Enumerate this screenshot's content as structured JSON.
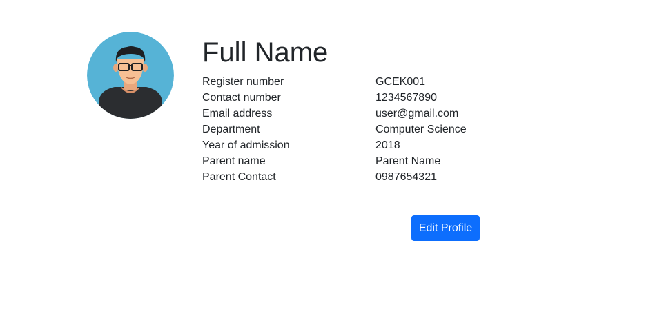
{
  "profile": {
    "name": "Full Name",
    "fields": [
      {
        "label": "Register number",
        "value": "GCEK001"
      },
      {
        "label": "Contact number",
        "value": "1234567890"
      },
      {
        "label": "Email address",
        "value": "user@gmail.com"
      },
      {
        "label": "Department",
        "value": "Computer Science"
      },
      {
        "label": "Year of admission",
        "value": "2018"
      },
      {
        "label": "Parent name",
        "value": "Parent Name"
      },
      {
        "label": "Parent Contact",
        "value": "0987654321"
      }
    ]
  },
  "actions": {
    "edit_label": "Edit Profile"
  },
  "avatar": {
    "icon": "user-avatar-icon"
  },
  "colors": {
    "accent": "#0d6efd",
    "avatar_bg": "#56b3d6",
    "text": "#212529"
  }
}
